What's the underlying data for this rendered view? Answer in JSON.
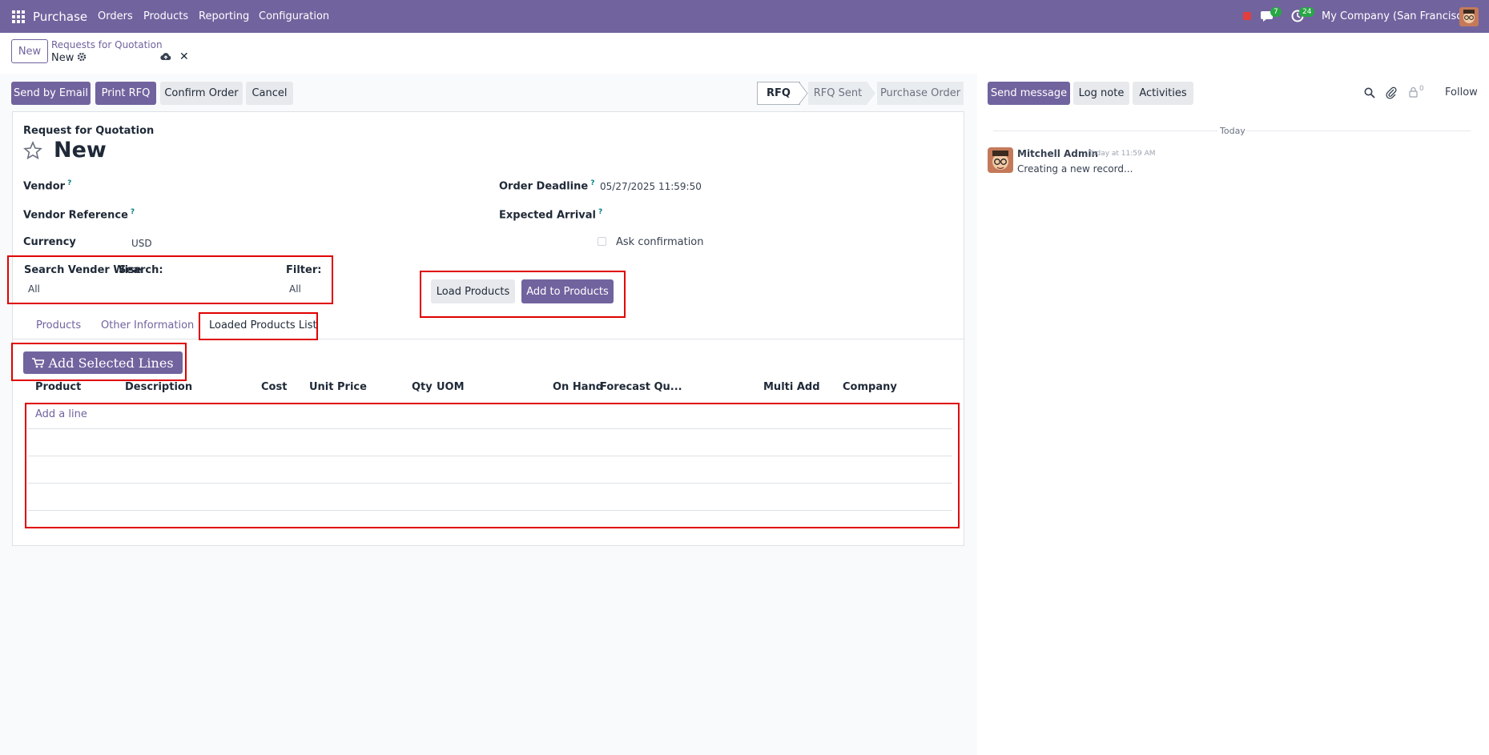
{
  "topbar": {
    "app_name": "Purchase",
    "menu": [
      "Orders",
      "Products",
      "Reporting",
      "Configuration"
    ],
    "messages_count": "7",
    "activities_count": "24",
    "company": "My Company (San Francisco)"
  },
  "control": {
    "new_label": "New",
    "breadcrumb_parent": "Requests for Quotation",
    "breadcrumb_current": "New"
  },
  "actions": {
    "send_email": "Send by Email",
    "print_rfq": "Print RFQ",
    "confirm_order": "Confirm Order",
    "cancel": "Cancel"
  },
  "statusbar": {
    "stages": [
      "RFQ",
      "RFQ Sent",
      "Purchase Order"
    ],
    "active": "RFQ"
  },
  "form": {
    "subtitle": "Request for Quotation",
    "title": "New",
    "vendor_label": "Vendor",
    "vendor_ref_label": "Vendor Reference",
    "currency_label": "Currency",
    "currency_value": "USD",
    "order_deadline_label": "Order Deadline",
    "order_deadline_value": "05/27/2025 11:59:50",
    "expected_arrival_label": "Expected Arrival",
    "ask_confirmation_label": "Ask confirmation",
    "search_vendor_label": "Search Vender Wise",
    "search_label": "Search:",
    "search_value": "All",
    "filter_label": "Filter:",
    "filter_value": "All",
    "load_products": "Load Products",
    "add_to_products": "Add to Products"
  },
  "tabs": [
    "Products",
    "Other Information",
    "Loaded Products List"
  ],
  "active_tab": "Loaded Products List",
  "list": {
    "add_selected": "Add Selected Lines",
    "columns": [
      "Product",
      "Description",
      "Cost",
      "Unit Price",
      "Qty",
      "UOM",
      "On Hand",
      "Forecast Qu...",
      "Multi Add",
      "Company"
    ],
    "add_line": "Add a line"
  },
  "chatter": {
    "send_message": "Send message",
    "log_note": "Log note",
    "activities": "Activities",
    "follower_count": "0",
    "follow": "Follow",
    "date_separator": "Today",
    "author": "Mitchell Admin",
    "timestamp": "Today at 11:59 AM",
    "message": "Creating a new record..."
  },
  "colors": {
    "brand": "#71639e",
    "highlight": "#e00000"
  }
}
